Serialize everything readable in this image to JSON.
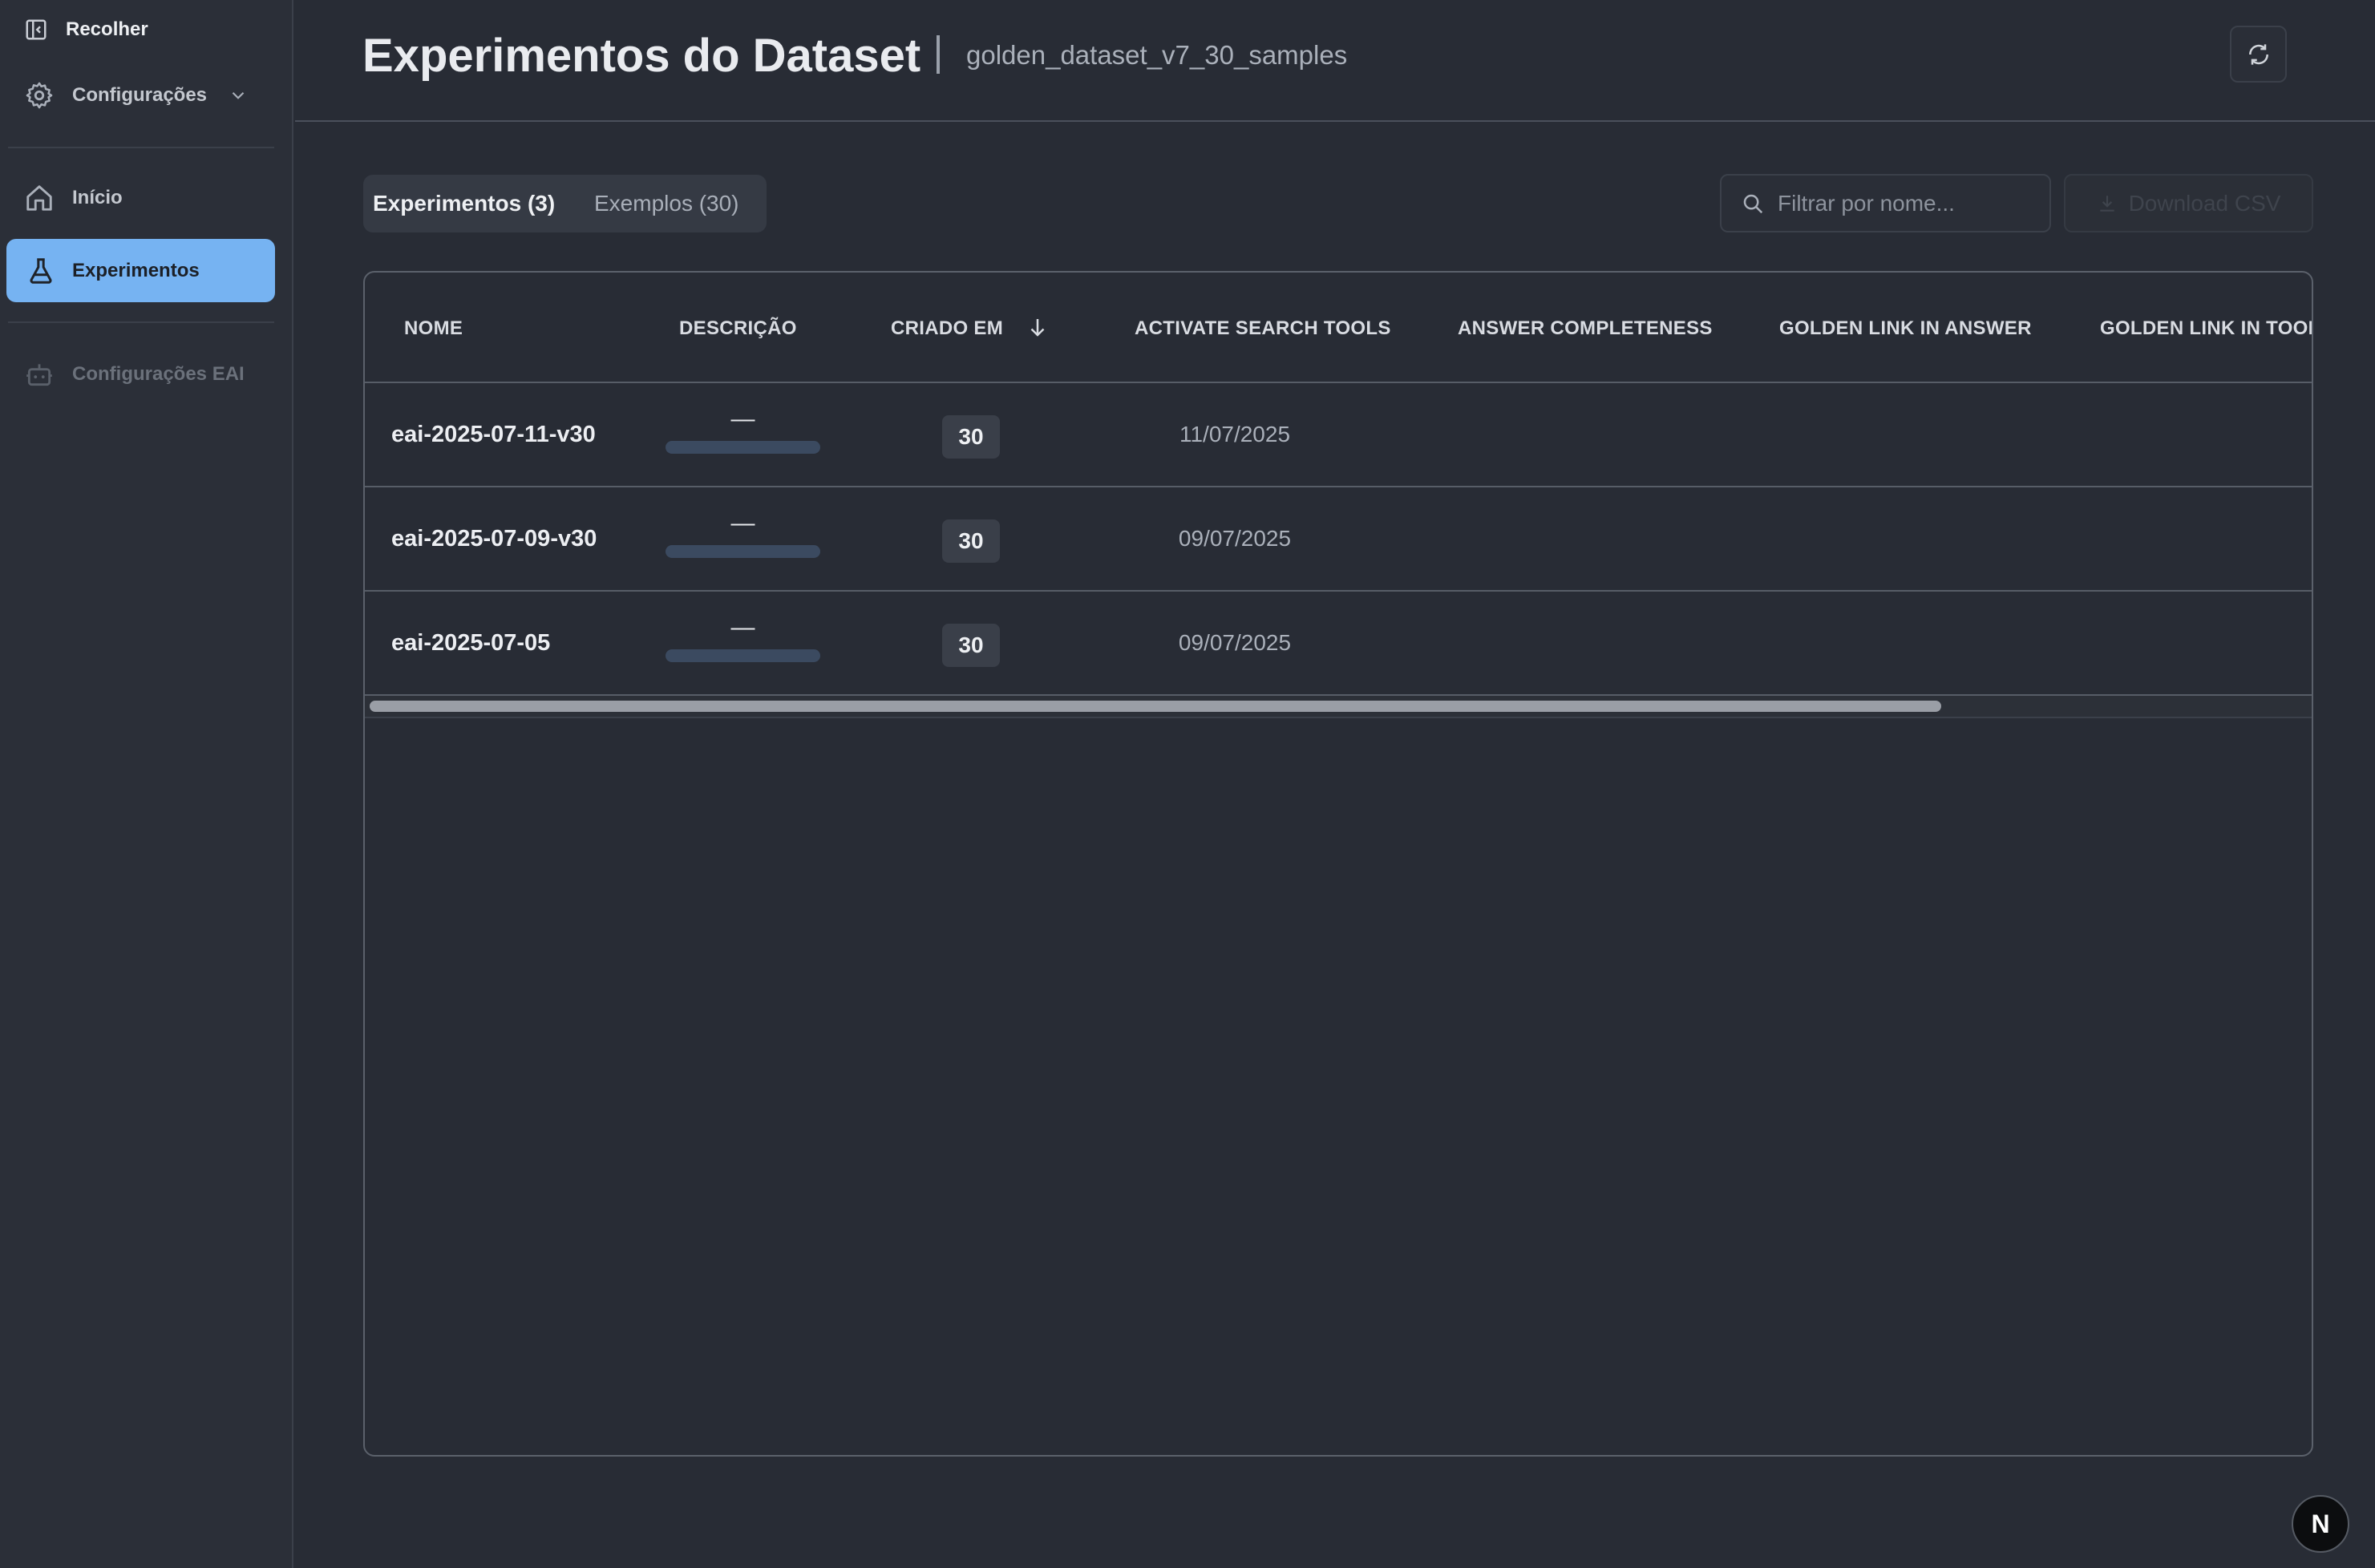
{
  "sidebar": {
    "collapse_label": "Recolher",
    "settings_label": "Configurações",
    "items": [
      {
        "label": "Início",
        "icon": "home-icon"
      },
      {
        "label": "Experimentos",
        "icon": "flask-icon"
      },
      {
        "label": "Configurações EAI",
        "icon": "robot-icon"
      }
    ],
    "active_item": "Experimentos",
    "active_color": "#76b3f2"
  },
  "header": {
    "title": "Experimentos do Dataset",
    "subtitle": "golden_dataset_v7_30_samples"
  },
  "tabs": [
    {
      "label": "Experimentos (3)",
      "active": true
    },
    {
      "label": "Exemplos (30)",
      "active": false
    }
  ],
  "search": {
    "placeholder": "Filtrar por nome...",
    "value": ""
  },
  "toolbar": {
    "download_label": "Download CSV"
  },
  "table": {
    "columns": [
      "NOME",
      "DESCRIÇÃO",
      "CRIADO EM",
      "ACTIVATE SEARCH TOOLS",
      "ANSWER COMPLETENESS",
      "GOLDEN LINK IN ANSWER",
      "GOLDEN LINK IN TOOL"
    ],
    "sort": {
      "column": "CRIADO EM",
      "direction": "descending"
    },
    "rows": [
      {
        "name": "eai-2025-07-11-v30",
        "description": "—",
        "count": "30",
        "date": "11/07/2025"
      },
      {
        "name": "eai-2025-07-09-v30",
        "description": "—",
        "count": "30",
        "date": "09/07/2025"
      },
      {
        "name": "eai-2025-07-05",
        "description": "—",
        "count": "30",
        "date": "09/07/2025"
      }
    ]
  },
  "badge": {
    "letter": "N"
  }
}
